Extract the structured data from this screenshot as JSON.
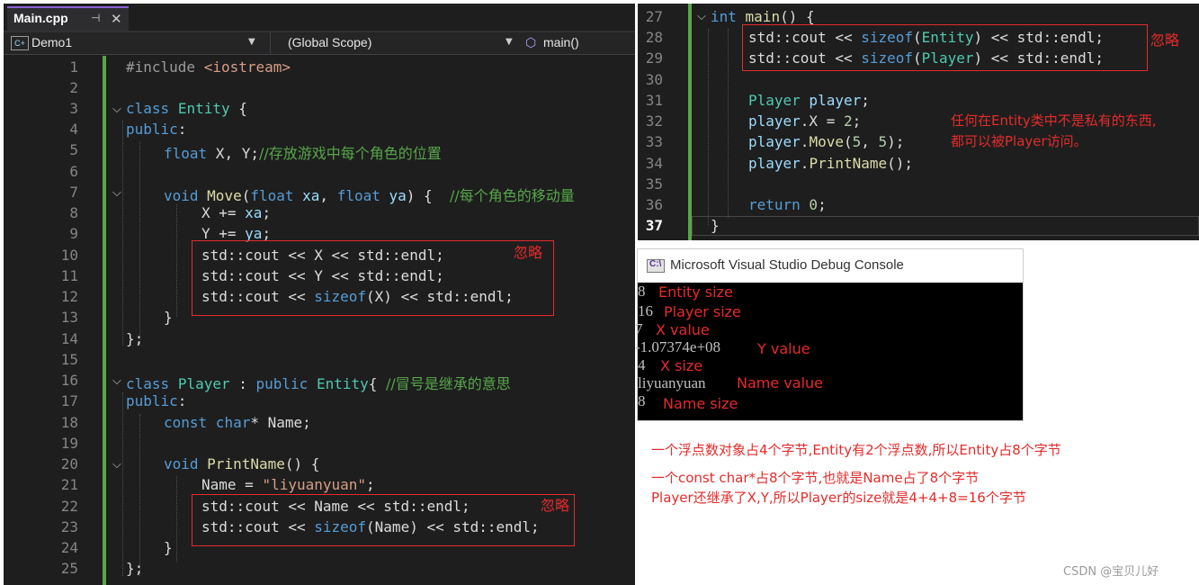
{
  "left_editor": {
    "tab": {
      "name": "Main.cpp",
      "pin_icon": "pin-icon",
      "close_icon": "close-icon"
    },
    "nav": {
      "project": "Demo1",
      "scope": "(Global Scope)",
      "member": "main()"
    },
    "lines": [
      {
        "n": "1"
      },
      {
        "n": "2"
      },
      {
        "n": "3"
      },
      {
        "n": "4"
      },
      {
        "n": "5"
      },
      {
        "n": "6"
      },
      {
        "n": "7"
      },
      {
        "n": "8"
      },
      {
        "n": "9"
      },
      {
        "n": "10"
      },
      {
        "n": "11"
      },
      {
        "n": "12"
      },
      {
        "n": "13"
      },
      {
        "n": "14"
      },
      {
        "n": "15"
      },
      {
        "n": "16"
      },
      {
        "n": "17"
      },
      {
        "n": "18"
      },
      {
        "n": "19"
      },
      {
        "n": "20"
      },
      {
        "n": "21"
      },
      {
        "n": "22"
      },
      {
        "n": "23"
      },
      {
        "n": "24"
      },
      {
        "n": "25"
      }
    ],
    "code": {
      "l1_pp": "#include ",
      "l1_inc": "<iostream>",
      "l3_kw": "class",
      "l3_ty": "Entity",
      "l3_rest": " {",
      "l4_kw": "public",
      "l4_rest": ":",
      "l5_kw": "float",
      "l5_rest": " X, Y;",
      "l5_cm": "//存放游戏中每个角色的位置",
      "l7_kw": "void",
      "l7_fn": "Move",
      "l7_p1": "(",
      "l7_kw2": "float",
      "l7_v1": " xa",
      "l7_p2": ", ",
      "l7_kw3": "float",
      "l7_v2": " ya",
      "l7_rest": ") {  ",
      "l7_cm": "//每个角色的移动量",
      "l8_a": "X += ",
      "l8_v": "xa",
      "l8_b": ";",
      "l9_a": "Y += ",
      "l9_v": "ya",
      "l9_b": ";",
      "l10": "std::cout << X << std::endl;",
      "l11": "std::cout << Y << std::endl;",
      "l12_a": "std::cout << ",
      "l12_kw": "sizeof",
      "l12_b": "(X) << std::endl;",
      "l13": "}",
      "l14": "};",
      "l16_kw": "class",
      "l16_ty": "Player",
      "l16_p": " : ",
      "l16_kw2": "public",
      "l16_ty2": " Entity",
      "l16_rest": "{ ",
      "l16_cm": "//冒号是继承的意思",
      "l17_kw": "public",
      "l17_rest": ":",
      "l18_kw": "const",
      "l18_kw2": " char",
      "l18_rest": "* Name;",
      "l20_kw": "void",
      "l20_fn": " PrintName",
      "l20_rest": "() {",
      "l21_a": "Name = ",
      "l21_str": "\"liyuanyuan\"",
      "l21_b": ";",
      "l22": "std::cout << Name << std::endl;",
      "l23_a": "std::cout << ",
      "l23_kw": "sizeof",
      "l23_b": "(Name) << std::endl;",
      "l24": "}",
      "l25": "};"
    },
    "annotations": {
      "ignore1": "忽略",
      "ignore2": "忽略"
    }
  },
  "right_editor": {
    "lines": [
      {
        "n": "27"
      },
      {
        "n": "28"
      },
      {
        "n": "29"
      },
      {
        "n": "30"
      },
      {
        "n": "31"
      },
      {
        "n": "32"
      },
      {
        "n": "33"
      },
      {
        "n": "34"
      },
      {
        "n": "35"
      },
      {
        "n": "36"
      },
      {
        "n": "37"
      }
    ],
    "code": {
      "l27_kw": "int",
      "l27_fn": " main",
      "l27_rest": "() {",
      "l28_a": "std::cout << ",
      "l28_kw": "sizeof",
      "l28_b": "(",
      "l28_ty": "Entity",
      "l28_c": ") << std::endl;",
      "l29_a": "std::cout << ",
      "l29_kw": "sizeof",
      "l29_b": "(",
      "l29_ty": "Player",
      "l29_c": ") << std::endl;",
      "l31_ty": "Player",
      "l31_v": " player",
      "l31_rest": ";",
      "l32_v": "player",
      "l32_rest": ".X = ",
      "l32_n": "2",
      "l32_end": ";",
      "l33_v": "player",
      "l33_p": ".",
      "l33_fn": "Move",
      "l33_a": "(",
      "l33_n1": "5",
      "l33_b": ", ",
      "l33_n2": "5",
      "l33_c": ");",
      "l34_v": "player",
      "l34_p": ".",
      "l34_fn": "PrintName",
      "l34_rest": "();",
      "l36_kw": "return",
      "l36_n": " 0",
      "l36_rest": ";",
      "l37": "}"
    },
    "annotations": {
      "ignore": "忽略",
      "note1": "任何在Entity类中不是私有的东西,",
      "note2": "都可以被Player访问。"
    }
  },
  "console": {
    "title": "Microsoft Visual Studio Debug Console",
    "icon": "console-icon",
    "outputs": [
      {
        "value": "8",
        "label": "Entity size"
      },
      {
        "value": "16",
        "label": "Player size"
      },
      {
        "value": "7",
        "label": "X value"
      },
      {
        "value": "-1.07374e+08",
        "label": "Y value"
      },
      {
        "value": "4",
        "label": "X size"
      },
      {
        "value": "liyuanyuan",
        "label": "Name value"
      },
      {
        "value": "8",
        "label": "Name size"
      }
    ]
  },
  "explanations": [
    "一个浮点数对象占4个字节,Entity有2个浮点数,所以Entity占8个字节",
    "一个const char*占8个字节,也就是Name占了8个字节",
    "Player还继承了X,Y,所以Player的size就是4+4+8=16个字节"
  ],
  "watermark": "CSDN @宝贝儿好"
}
